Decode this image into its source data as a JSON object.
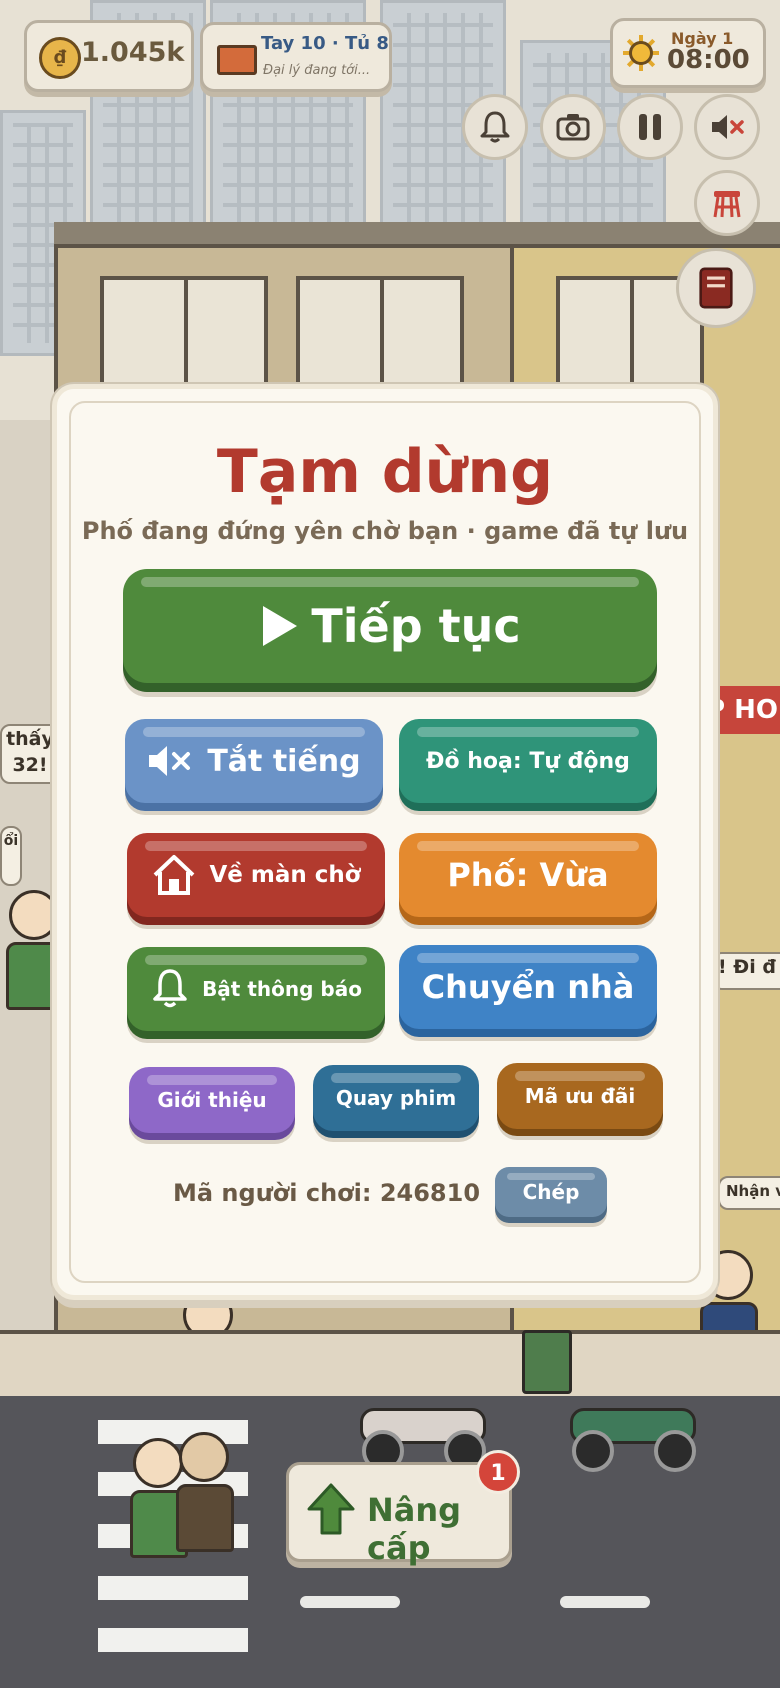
{
  "hud": {
    "coins": "1.045k",
    "task_title": "Tay 10 · Tủ 8",
    "task_subtitle": "Đại lý đang tới...",
    "day": "Ngày 1",
    "time": "08:00",
    "icons": [
      "bell-icon",
      "camera-icon",
      "pause-icon",
      "mute-icon",
      "stool-icon",
      "book-icon"
    ]
  },
  "scene": {
    "bubble_left_1": "thấy",
    "bubble_left_2": "32!",
    "bubble_left_3": "ổi",
    "bubble_right_1": "! Đi đ",
    "bubble_right_2": "Nhận v",
    "shop_sign": "P HO"
  },
  "pause_menu": {
    "title": "Tạm dừng",
    "subtitle": "Phố đang đứng yên chờ bạn · game đã tự lưu",
    "continue": "Tiếp tục",
    "mute": "Tắt tiếng",
    "graphics": "Đồ hoạ: Tự động",
    "home": "Về màn chờ",
    "street": "Phố: Vừa",
    "notifications": "Bật thông báo",
    "move_house": "Chuyển nhà",
    "intro": "Giới thiệu",
    "record": "Quay phim",
    "promo": "Mã ưu đãi",
    "player_code": "Mã người chơi: 246810",
    "copy": "Chép"
  },
  "upgrade": {
    "label": "Nâng cấp",
    "badge": "1"
  },
  "colors": {
    "title_red": "#b23a2e",
    "green": "#4f8a3c",
    "blue": "#3f83c6",
    "orange": "#e48a2f",
    "purple": "#8e68c8"
  }
}
